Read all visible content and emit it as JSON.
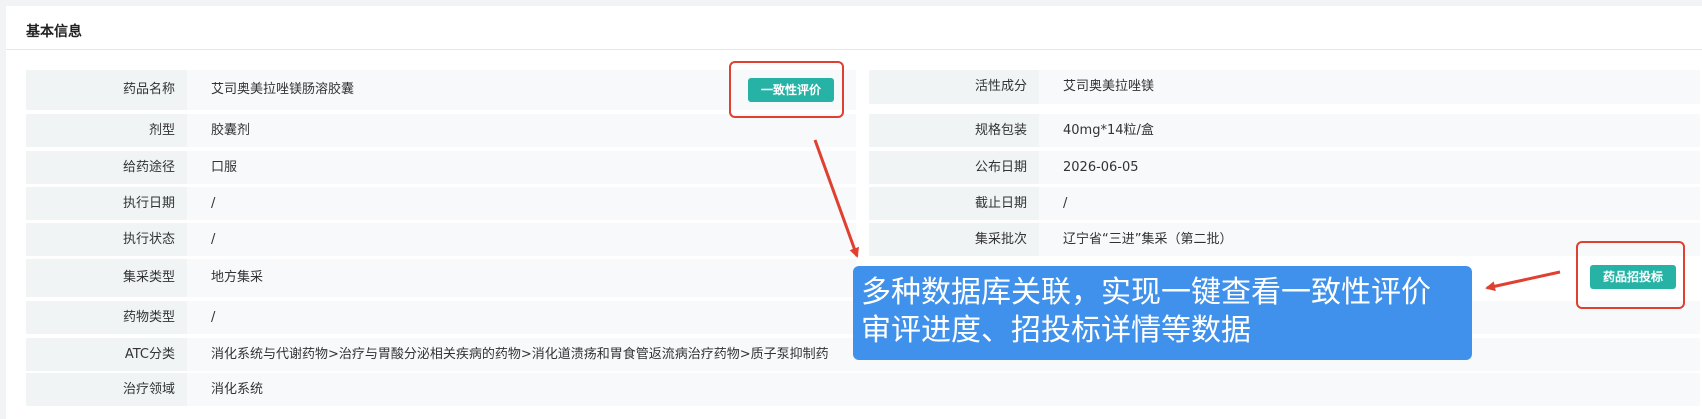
{
  "section_title": "基本信息",
  "left_fields": [
    {
      "label": "药品名称",
      "value": "艾司奥美拉唑镁肠溶胶囊"
    },
    {
      "label": "剂型",
      "value": "胶囊剂"
    },
    {
      "label": "给药途径",
      "value": "口服"
    },
    {
      "label": "执行日期",
      "value": "/"
    },
    {
      "label": "执行状态",
      "value": "/"
    },
    {
      "label": "集采类型",
      "value": "地方集采"
    },
    {
      "label": "药物类型",
      "value": "/"
    },
    {
      "label": "ATC分类",
      "value": "消化系统与代谢药物>治疗与胃酸分泌相关疾病的药物>消化道溃疡和胃食管返流病治疗药物>质子泵抑制药"
    },
    {
      "label": "治疗领域",
      "value": "消化系统"
    }
  ],
  "right_fields": [
    {
      "label": "活性成分",
      "value": "艾司奥美拉唑镁"
    },
    {
      "label": "规格包装",
      "value": "40mg*14粒/盒"
    },
    {
      "label": "公布日期",
      "value": "2026-06-05"
    },
    {
      "label": "截止日期",
      "value": "/"
    },
    {
      "label": "集采批次",
      "value": "辽宁省“三进”集采（第二批）"
    }
  ],
  "buttons": {
    "consistency_eval": "一致性评价",
    "drug_bidding": "药品招投标"
  },
  "callout": {
    "line1": "多种数据库关联，实现一键查看一致性评价",
    "line2": "审评进度、招投标详情等数据"
  },
  "colors": {
    "accent_teal": "#26b3a6",
    "highlight_red": "#e0402f",
    "callout_blue": "#3f91ec"
  }
}
